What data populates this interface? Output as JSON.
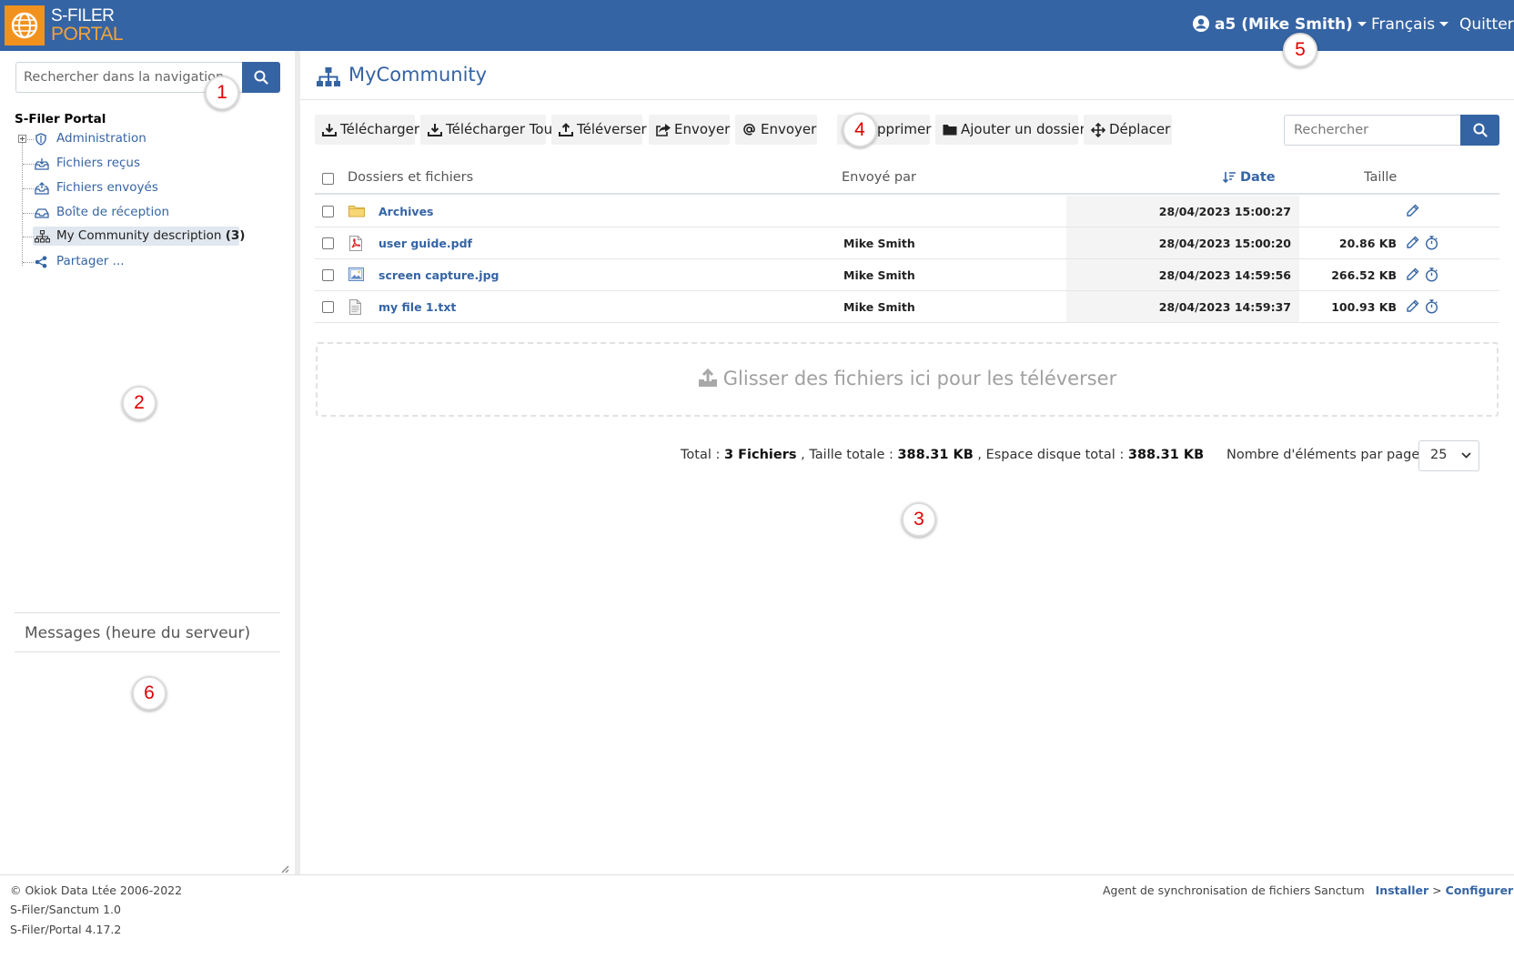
{
  "header": {
    "brand_line1": "S-FILER",
    "brand_line2": "PORTAL",
    "user_label": "a5 (Mike Smith)",
    "language_label": "Français",
    "quit_label": "Quitter"
  },
  "sidebar": {
    "search_placeholder": "Rechercher dans la navigation",
    "root_label": "S-Filer Portal",
    "items": [
      {
        "label": "Administration",
        "icon": "shield-icon"
      },
      {
        "label": "Fichiers reçus",
        "icon": "inbox-download-icon"
      },
      {
        "label": "Fichiers envoyés",
        "icon": "outbox-upload-icon"
      },
      {
        "label": "Boîte de réception",
        "icon": "tray-icon"
      },
      {
        "label": "My Community description",
        "count": "(3)",
        "icon": "sitemap-icon"
      },
      {
        "label": "Partager ...",
        "icon": "share-icon"
      }
    ],
    "messages_title": "Messages (heure du serveur)"
  },
  "main": {
    "title": "MyCommunity",
    "toolbar": {
      "download": "Télécharger",
      "download_all": "Télécharger Tout",
      "upload": "Téléverser",
      "send": "Envoyer",
      "send_email": "Envoyer",
      "delete": "Supprimer",
      "add_folder": "Ajouter un dossier",
      "move": "Déplacer"
    },
    "search_placeholder": "Rechercher",
    "table": {
      "col_name": "Dossiers et fichiers",
      "col_sender": "Envoyé par",
      "col_date": "Date",
      "col_size": "Taille",
      "rows": [
        {
          "name": "Archives",
          "type": "folder",
          "sender": "",
          "date": "28/04/2023 15:00:27",
          "size": ""
        },
        {
          "name": "user guide.pdf",
          "type": "pdf",
          "sender": "Mike Smith",
          "date": "28/04/2023 15:00:20",
          "size": "20.86 KB"
        },
        {
          "name": "screen capture.jpg",
          "type": "image",
          "sender": "Mike Smith",
          "date": "28/04/2023 14:59:56",
          "size": "266.52 KB"
        },
        {
          "name": "my file 1.txt",
          "type": "text",
          "sender": "Mike Smith",
          "date": "28/04/2023 14:59:37",
          "size": "100.93 KB"
        }
      ]
    },
    "dropzone_text": "Glisser des fichiers ici pour les téléverser",
    "summary": {
      "total_label": "Total :",
      "files_value": "3 Fichiers",
      "size_label": ", Taille totale :",
      "size_value": "388.31 KB",
      "disk_label": ", Espace disque total :",
      "disk_value": "388.31 KB"
    },
    "per_page_label": "Nombre d'éléments par page",
    "per_page_value": "25"
  },
  "footer": {
    "copyright": "© Okiok Data Ltée 2006-2022",
    "version_sanctum": "S-Filer/Sanctum 1.0",
    "version_portal": "S-Filer/Portal 4.17.2",
    "sync_label": "Agent de synchronisation de fichiers Sanctum",
    "install_label": "Installer",
    "separator": ">",
    "configure_label": "Configurer"
  },
  "callouts": [
    "1",
    "2",
    "3",
    "4",
    "5",
    "6"
  ],
  "colors": {
    "accent": "#3564a4",
    "logo": "#f2921e",
    "callout_text": "#e00000"
  }
}
